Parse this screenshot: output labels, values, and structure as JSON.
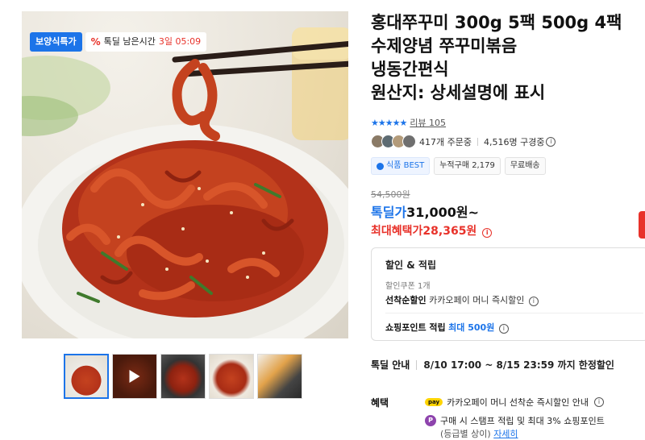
{
  "badges": {
    "category": "보양식특가",
    "discount_icon": "%",
    "timer_label": "톡딜 남은시간",
    "timer_value": "3일 05:09"
  },
  "thumbnails": [
    {
      "name": "thumb-1",
      "active": true
    },
    {
      "name": "thumb-video",
      "active": false,
      "icon": "play-icon"
    },
    {
      "name": "thumb-3",
      "active": false
    },
    {
      "name": "thumb-4",
      "active": false
    },
    {
      "name": "thumb-5",
      "active": false
    }
  ],
  "product": {
    "title_lines": [
      "홍대쭈꾸미 300g 5팩 500g 4팩",
      "수제양념 쭈꾸미볶음",
      "냉동간편식",
      "원산지: 상세설명에 표시"
    ],
    "stars": "★★★★★",
    "review": "리뷰 105",
    "orders": "417개 주문중",
    "viewers": "4,516명 구경중",
    "tags": {
      "best": "식품 BEST",
      "cumulative": "누적구매 2,179",
      "shipping": "무료배송"
    },
    "original_price": "54,500원",
    "sale_label": "톡딜가",
    "sale_price": "31,000원~",
    "max_benefit_label": "최대혜택가",
    "max_benefit_price": "28,365원"
  },
  "discount_box": {
    "title": "할인 & 적립",
    "coupon": "할인쿠폰 1개",
    "first_label": "선착순할인",
    "first_text": "카카오페이 머니 즉시할인",
    "point_label": "쇼핑포인트 적립",
    "point_value": "최대 500원"
  },
  "deal": {
    "label": "톡딜 안내",
    "text": "8/10 17:00 ~ 8/15 23:59 까지 한정할인"
  },
  "benefits": {
    "label": "혜택",
    "pay_badge": "pay",
    "line1": "카카오페이 머니 선착순 즉시할인 안내",
    "p_badge": "P",
    "line2": "구매 시 스탬프 적립 및 최대 3% 쇼핑포인트",
    "line3": "(등급별 상이)",
    "detail_link": "자세히"
  },
  "colors": {
    "accent": "#1c74e9",
    "sale": "#e8322a"
  }
}
